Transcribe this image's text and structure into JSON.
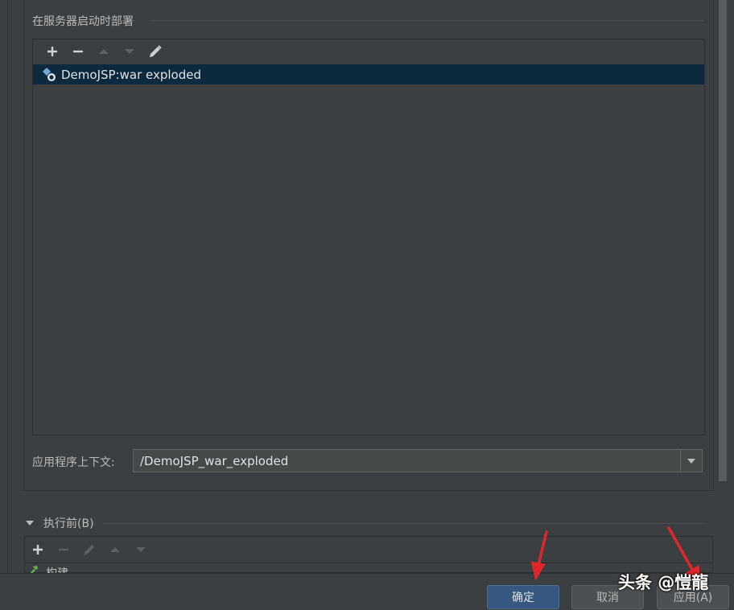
{
  "deploy_section": {
    "title": "在服务器启动时部署",
    "toolbar": {
      "add_icon": "plus-icon",
      "remove_icon": "minus-icon",
      "up_icon": "arrow-up-icon",
      "down_icon": "arrow-down-icon",
      "edit_icon": "pencil-icon"
    },
    "items": [
      {
        "label": "DemoJSP:war exploded",
        "icon": "artifact-icon",
        "selected": true
      }
    ]
  },
  "context": {
    "label": "应用程序上下文:",
    "value": "/DemoJSP_war_exploded"
  },
  "before_launch": {
    "title": "执行前(B)",
    "items": [
      {
        "label": "构建",
        "icon": "build-hammer-icon"
      }
    ]
  },
  "footer": {
    "ok_label": "确定",
    "cancel_label": "取消",
    "apply_label": "应用(A)"
  },
  "watermark": "头条 @愷龍",
  "colors": {
    "background": "#3c3f41",
    "selection": "#0d293e",
    "primary_button": "#365880",
    "annotation_arrow": "#e0262b"
  }
}
